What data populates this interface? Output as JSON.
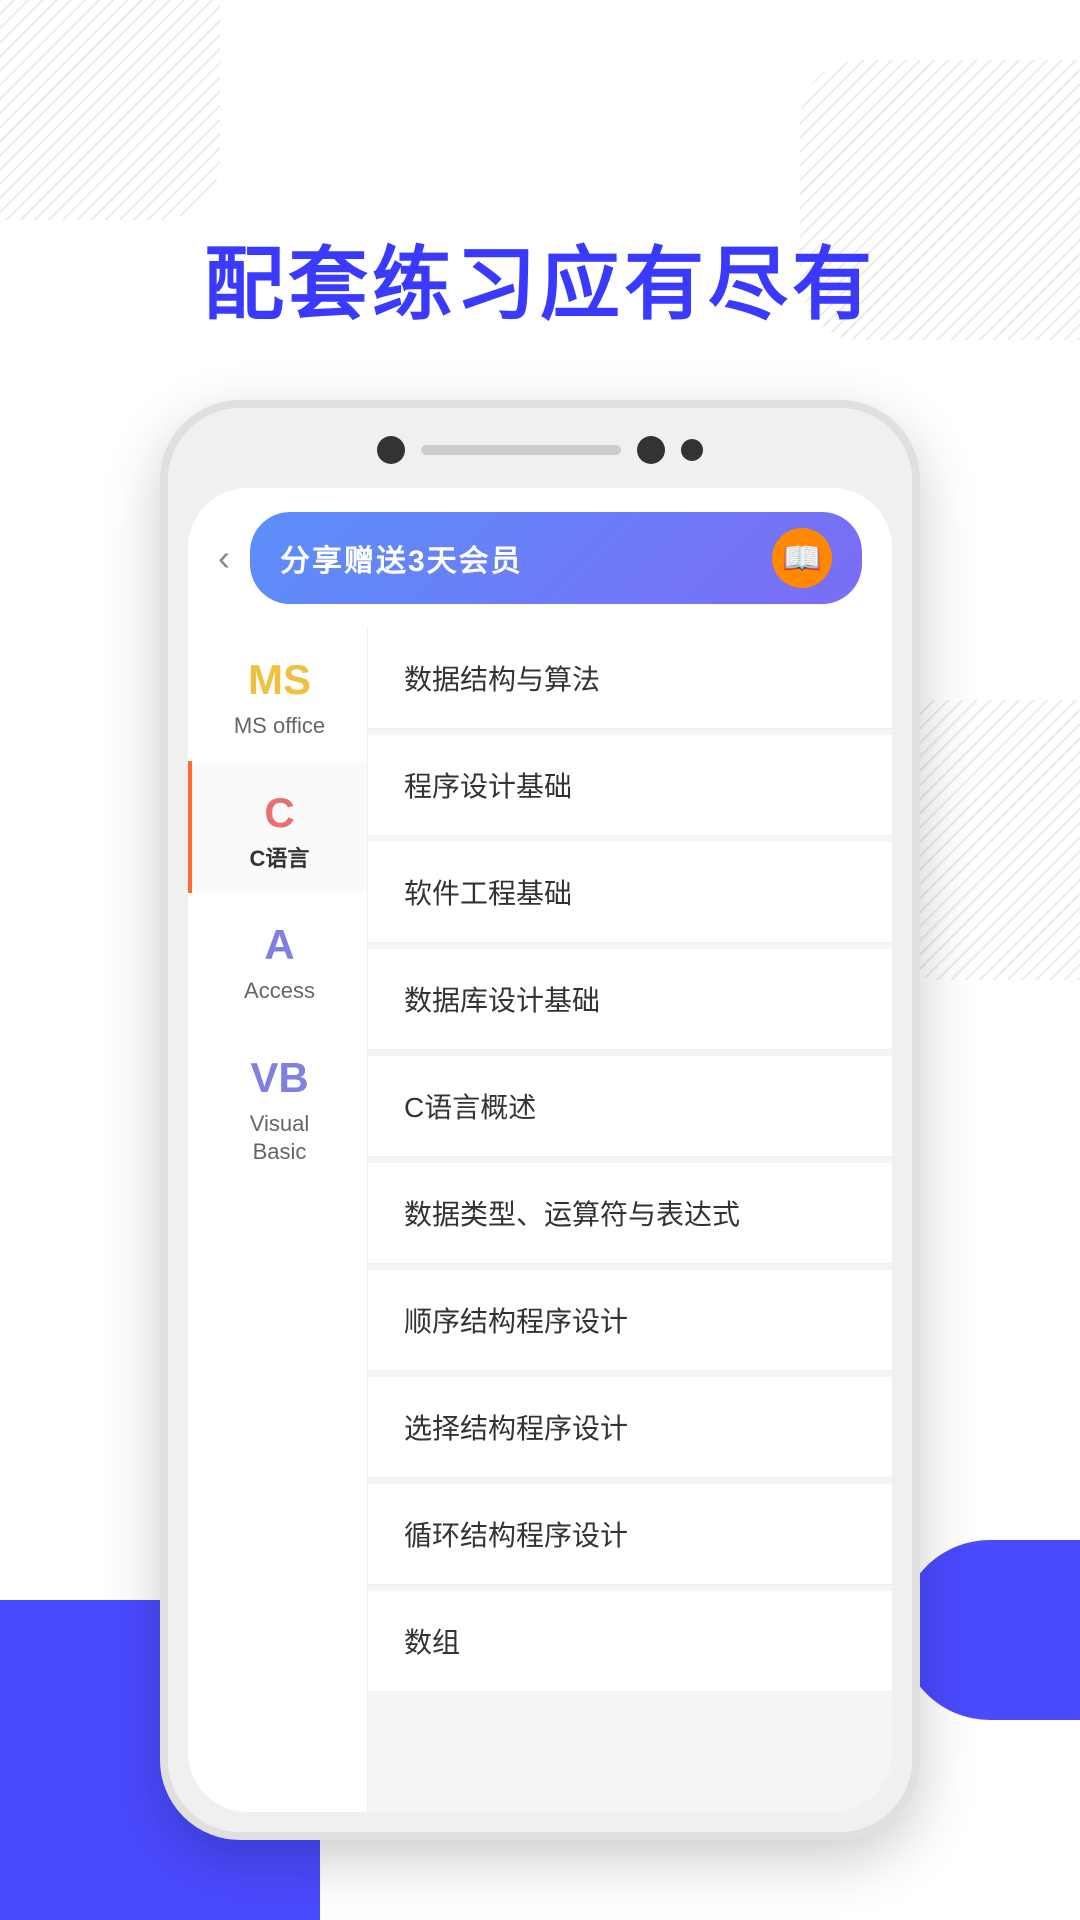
{
  "heading": "配套练习应有尽有",
  "phone": {
    "back_btn": "‹",
    "share_banner_text": "分享赠送3天会员",
    "indicator_dots": [
      "•",
      "•",
      "•"
    ]
  },
  "sidebar": {
    "items": [
      {
        "id": "ms-office",
        "icon": "MS",
        "icon_class": "ms",
        "label": "MS office",
        "active": false
      },
      {
        "id": "c-lang",
        "icon": "C",
        "icon_class": "c",
        "label": "C语言",
        "active": true
      },
      {
        "id": "access",
        "icon": "A",
        "icon_class": "access",
        "label": "Access",
        "active": false
      },
      {
        "id": "vb",
        "icon": "VB",
        "icon_class": "vb",
        "label": "Visual\nBasic",
        "active": false
      }
    ]
  },
  "list": {
    "items": [
      "数据结构与算法",
      "程序设计基础",
      "软件工程基础",
      "数据库设计基础",
      "C语言概述",
      "数据类型、运算符与表达式",
      "顺序结构程序设计",
      "选择结构程序设计",
      "循环结构程序设计",
      "数组"
    ]
  }
}
